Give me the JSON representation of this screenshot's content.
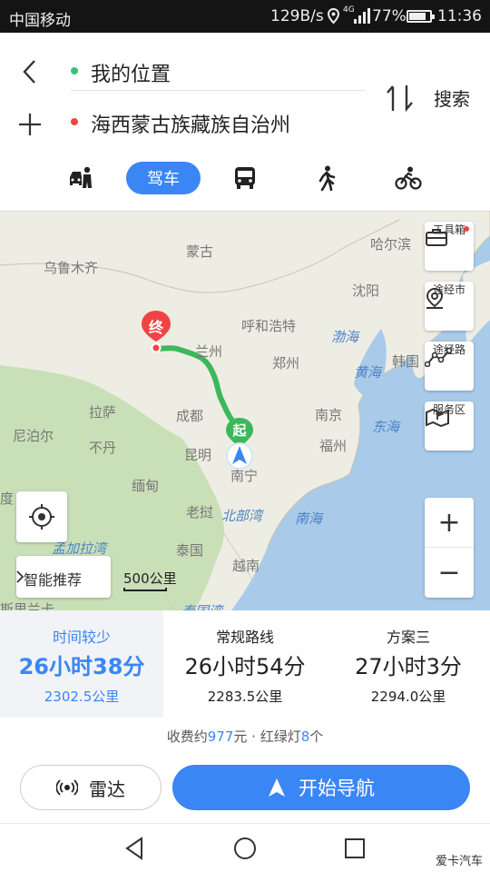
{
  "status_bar": {
    "carrier": "中国移动",
    "speed": "129B/s",
    "network": "4G",
    "battery": "77%",
    "battery_level": 0.77,
    "time": "11:36"
  },
  "route": {
    "origin": "我的位置",
    "destination": "海西蒙古族藏族自治州",
    "search_label": "搜索",
    "origin_color": "#3ec07a",
    "destination_color": "#f04444"
  },
  "modes": {
    "drive": "驾车",
    "active": "drive",
    "icons": [
      "taxi-icon",
      "bus-icon",
      "walk-icon",
      "bike-icon"
    ]
  },
  "map": {
    "labels": {
      "mongolia": "蒙古",
      "urumqi": "乌鲁木齐",
      "harbin": "哈尔滨",
      "shenyang": "沈阳",
      "hohhot": "呼和浩特",
      "lanzhou": "兰州",
      "zhengzhou": "郑州",
      "bohai": "渤海",
      "yellow_sea": "黄海",
      "korea": "韩国",
      "lhasa": "拉萨",
      "chengdu": "成都",
      "nanjing": "南京",
      "east_sea": "东海",
      "nepal": "尼泊尔",
      "bhutan": "不丹",
      "kunming": "昆明",
      "fuzhou": "福州",
      "myanmar": "缅甸",
      "nanning": "南宁",
      "india": "度",
      "laos": "老挝",
      "beibu_gulf": "北部湾",
      "south_sea": "南海",
      "bengal_bay": "孟加拉湾",
      "thailand": "泰国",
      "vietnam": "越南",
      "sri_lanka": "斯里兰卡",
      "thai_gulf": "泰国湾"
    },
    "start_marker": "起",
    "end_marker": "终",
    "tools": {
      "toolbox": "工具箱",
      "via_city": "途经市",
      "via_road": "途经路",
      "service_area": "服务区"
    },
    "smart_recommend": "智能推荐",
    "scale": "500公里",
    "zoom_in": "+",
    "zoom_out": "−"
  },
  "plans": [
    {
      "label": "时间较少",
      "time": "26小时38分",
      "distance": "2302.5公里",
      "selected": true
    },
    {
      "label": "常规路线",
      "time": "26小时54分",
      "distance": "2283.5公里",
      "selected": false
    },
    {
      "label": "方案三",
      "time": "27小时3分",
      "distance": "2294.0公里",
      "selected": false
    }
  ],
  "summary": {
    "toll_prefix": "收费约",
    "toll_amount": "977",
    "toll_suffix": "元 · 红绿灯",
    "lights": "8",
    "lights_suffix": "个"
  },
  "actions": {
    "radar": "雷达",
    "start_navigation": "开始导航"
  },
  "watermark": "爱卡汽车",
  "colors": {
    "accent": "#3a86f5",
    "route_line": "#3cb85a"
  }
}
